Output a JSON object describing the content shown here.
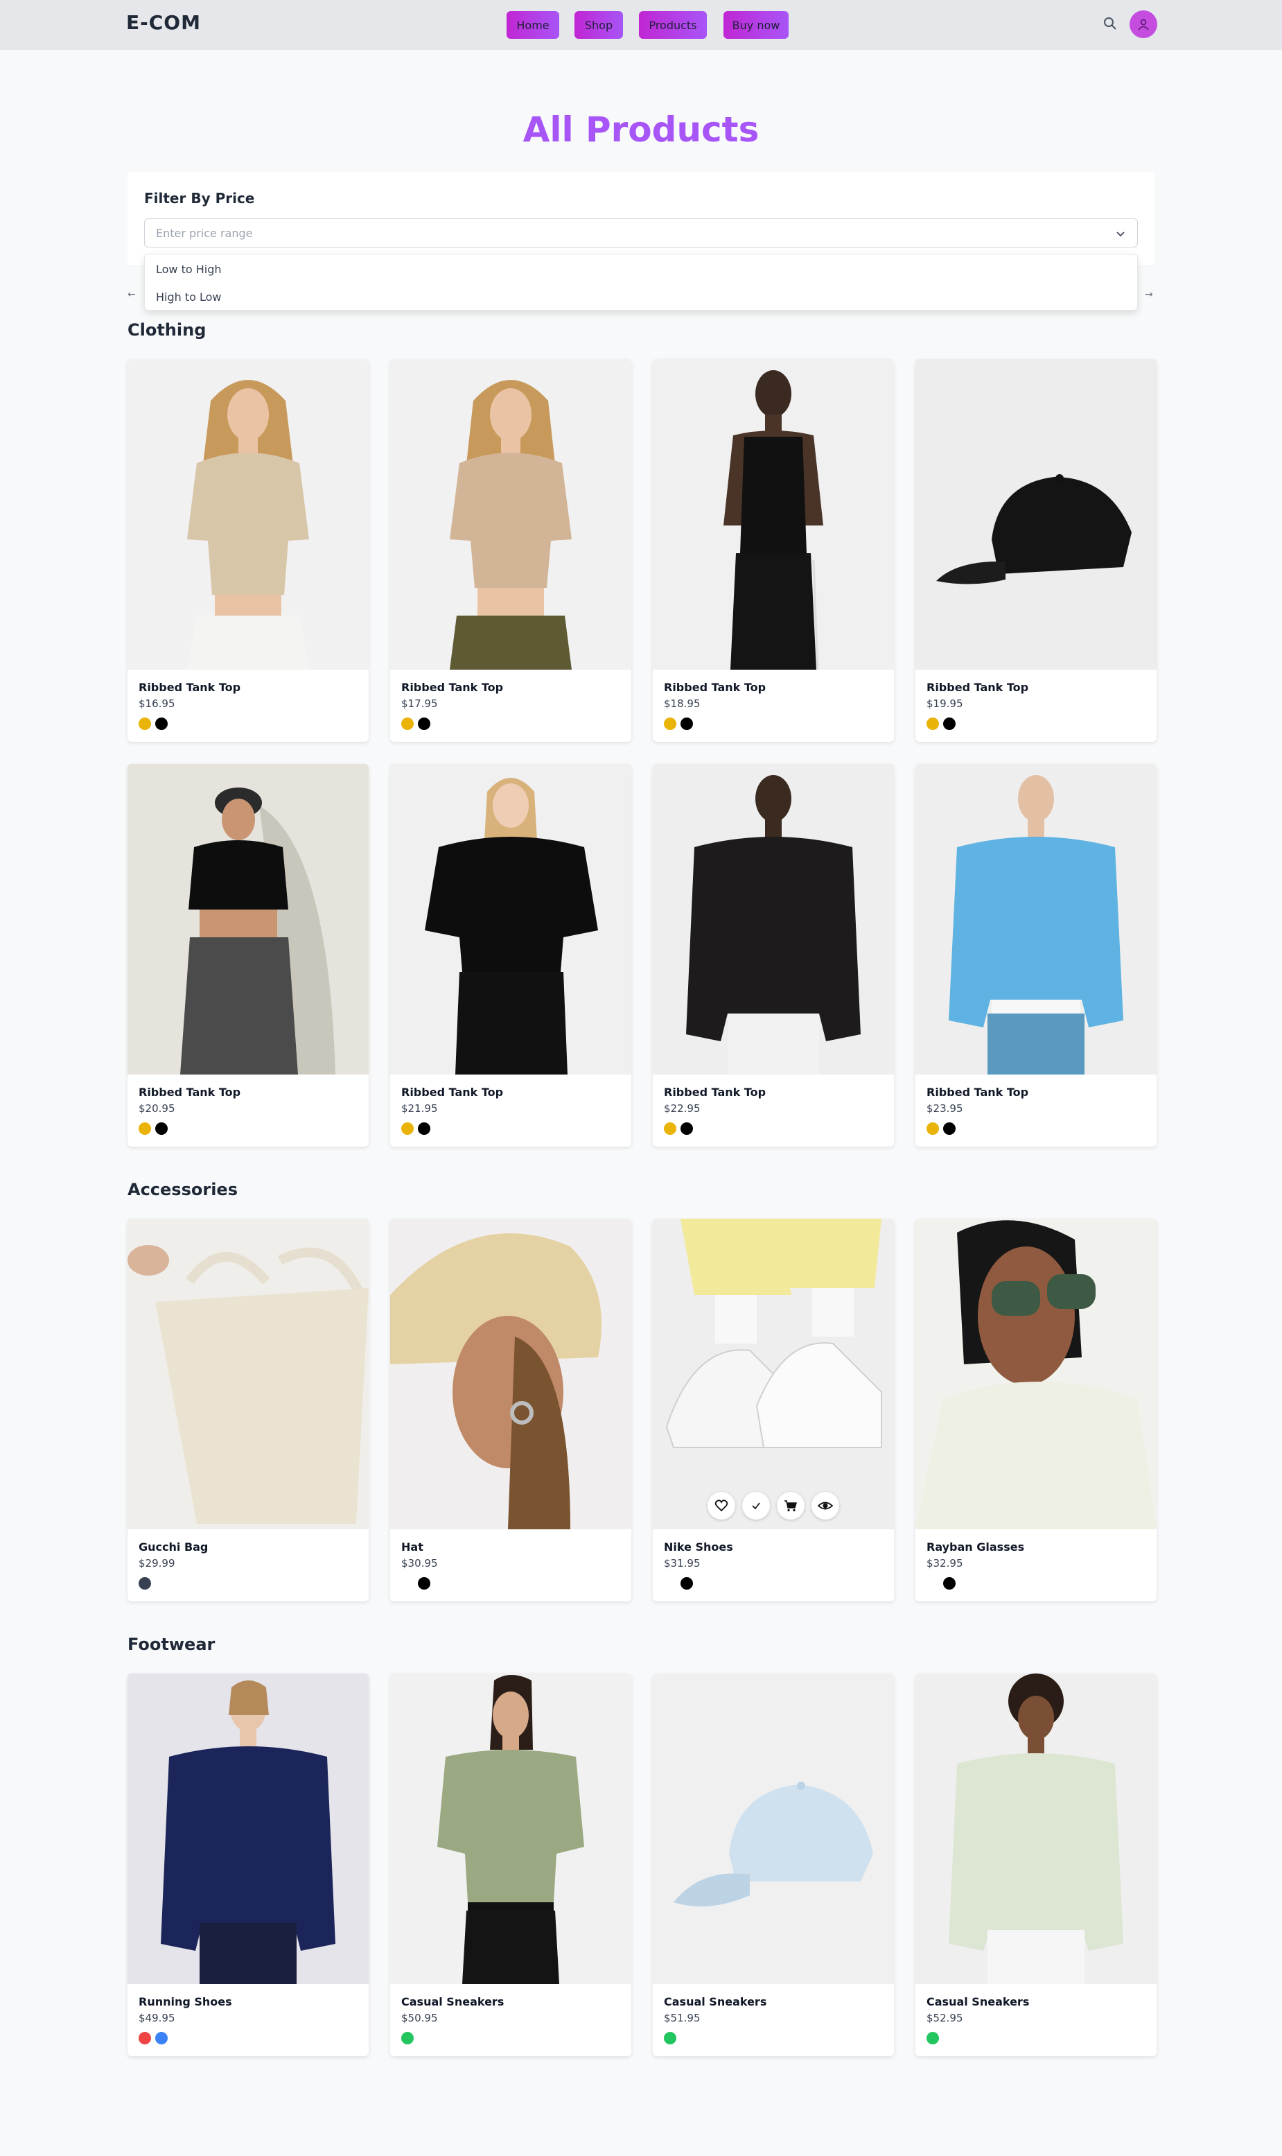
{
  "header": {
    "logo": "E-COM",
    "nav": [
      "Home",
      "Shop",
      "Products",
      "Buy now"
    ],
    "accent": "#a855f7"
  },
  "page": {
    "title": "All Products"
  },
  "filter": {
    "label": "Filter By Price",
    "placeholder": "Enter price range",
    "options": [
      "Low to High",
      "High to Low"
    ],
    "prev_arrow": "←",
    "next_arrow": "→"
  },
  "sections": [
    {
      "title": "Clothing",
      "products": [
        {
          "name": "Ribbed Tank Top",
          "price": "$16.95",
          "colors": [
            "#eab308",
            "#000000"
          ],
          "image": "woman-beige-tee-white-pants"
        },
        {
          "name": "Ribbed Tank Top",
          "price": "$17.95",
          "colors": [
            "#eab308",
            "#000000"
          ],
          "image": "woman-beige-tee-olive-pants"
        },
        {
          "name": "Ribbed Tank Top",
          "price": "$18.95",
          "colors": [
            "#eab308",
            "#000000"
          ],
          "image": "woman-black-tank"
        },
        {
          "name": "Ribbed Tank Top",
          "price": "$19.95",
          "colors": [
            "#eab308",
            "#000000"
          ],
          "image": "black-cap"
        },
        {
          "name": "Ribbed Tank Top",
          "price": "$20.95",
          "colors": [
            "#eab308",
            "#000000"
          ],
          "image": "woman-black-crop-tee"
        },
        {
          "name": "Ribbed Tank Top",
          "price": "$21.95",
          "colors": [
            "#eab308",
            "#000000"
          ],
          "image": "woman-black-oversized-tee"
        },
        {
          "name": "Ribbed Tank Top",
          "price": "$22.95",
          "colors": [
            "#eab308",
            "#000000"
          ],
          "image": "man-black-sweatshirt"
        },
        {
          "name": "Ribbed Tank Top",
          "price": "$23.95",
          "colors": [
            "#eab308",
            "#000000"
          ],
          "image": "man-blue-sweatshirt"
        }
      ]
    },
    {
      "title": "Accessories",
      "products": [
        {
          "name": "Gucchi Bag",
          "price": "$29.99",
          "colors": [
            "#374151"
          ],
          "image": "cream-tote-bag"
        },
        {
          "name": "Hat",
          "price": "$30.95",
          "colors": [
            "#000000"
          ],
          "image": "woman-straw-hat"
        },
        {
          "name": "Nike Shoes",
          "price": "$31.95",
          "colors": [
            "#000000"
          ],
          "image": "white-sneakers"
        },
        {
          "name": "Rayban Glasses",
          "price": "$32.95",
          "colors": [
            "#000000"
          ],
          "image": "woman-sunglasses"
        }
      ]
    },
    {
      "title": "Footwear",
      "products": [
        {
          "name": "Running Shoes",
          "price": "$49.95",
          "colors": [
            "#ef4444",
            "#3b82f6"
          ],
          "image": "man-navy-sweatshirt"
        },
        {
          "name": "Casual Sneakers",
          "price": "$50.95",
          "colors": [
            "#22c55e"
          ],
          "image": "woman-green-tee"
        },
        {
          "name": "Casual Sneakers",
          "price": "$51.95",
          "colors": [
            "#22c55e"
          ],
          "image": "light-blue-cap"
        },
        {
          "name": "Casual Sneakers",
          "price": "$52.95",
          "colors": [
            "#22c55e"
          ],
          "image": "man-sage-sweatshirt"
        }
      ]
    }
  ],
  "hover_actions": [
    "heart-icon",
    "check-icon",
    "cart-icon",
    "eye-icon"
  ]
}
